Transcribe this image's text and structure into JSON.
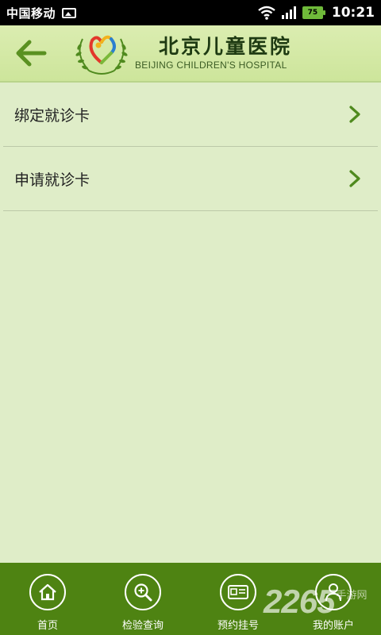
{
  "status_bar": {
    "carrier": "中国移动",
    "battery": "75",
    "time": "10:21"
  },
  "header": {
    "title_cn": "北京儿童医院",
    "title_en": "BEIJING CHILDREN'S HOSPITAL"
  },
  "menu": {
    "items": [
      {
        "label": "绑定就诊卡"
      },
      {
        "label": "申请就诊卡"
      }
    ]
  },
  "nav": {
    "items": [
      {
        "label": "首页",
        "icon": "home-icon"
      },
      {
        "label": "检验查询",
        "icon": "search-icon"
      },
      {
        "label": "预约挂号",
        "icon": "card-icon"
      },
      {
        "label": "我的账户",
        "icon": "user-icon"
      }
    ]
  },
  "watermark": {
    "number": "2265",
    "text": "手游网"
  },
  "colors": {
    "header_bg": "#d4e9a5",
    "page_bg": "#dfedc8",
    "nav_bg": "#4e8312",
    "accent": "#5a9121"
  }
}
